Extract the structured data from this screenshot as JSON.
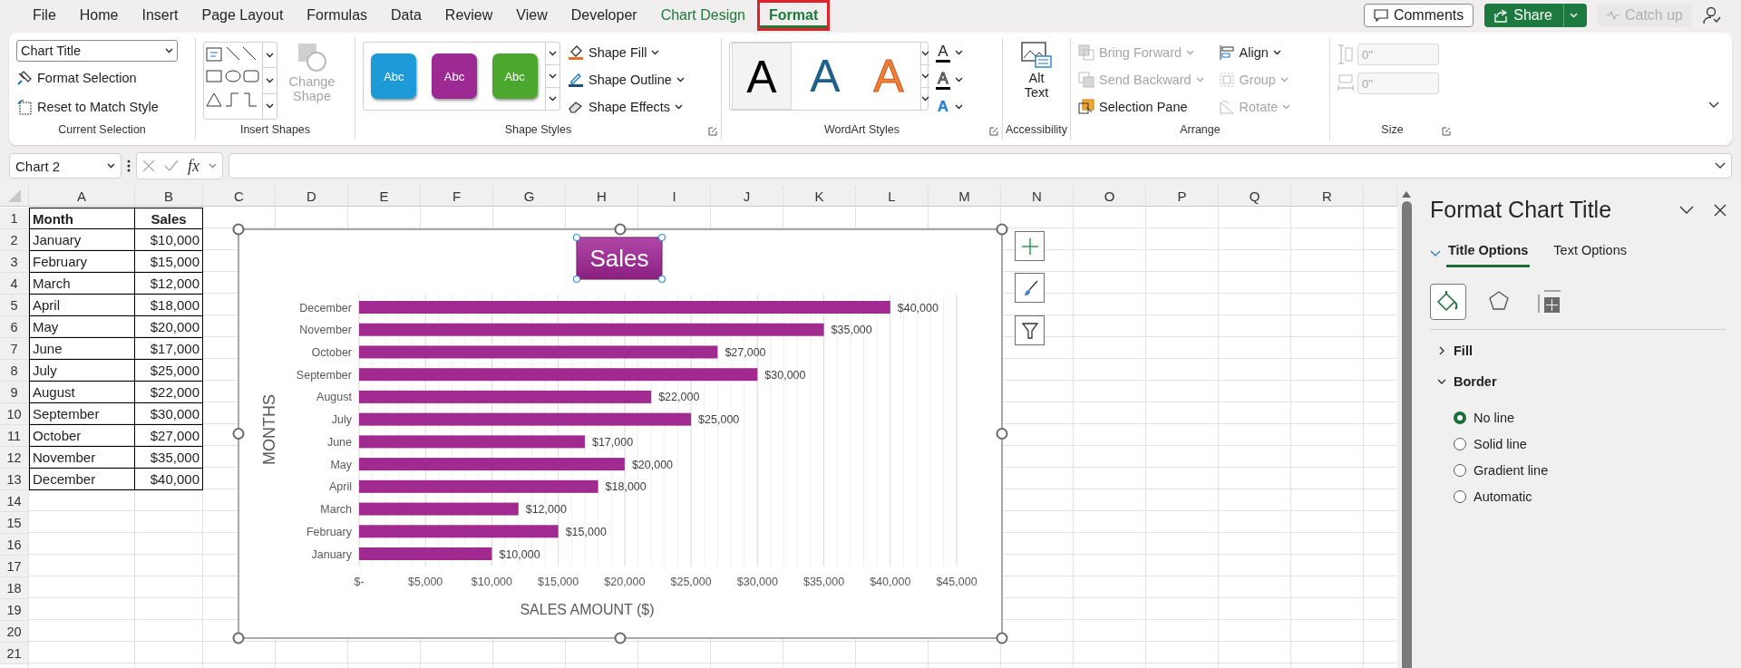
{
  "ribbon_tabs": [
    {
      "label": "File",
      "selected": false,
      "contextual": false,
      "highlighted": false
    },
    {
      "label": "Home",
      "selected": false,
      "contextual": false,
      "highlighted": false
    },
    {
      "label": "Insert",
      "selected": false,
      "contextual": false,
      "highlighted": false
    },
    {
      "label": "Page Layout",
      "selected": false,
      "contextual": false,
      "highlighted": false
    },
    {
      "label": "Formulas",
      "selected": false,
      "contextual": false,
      "highlighted": false
    },
    {
      "label": "Data",
      "selected": false,
      "contextual": false,
      "highlighted": false
    },
    {
      "label": "Review",
      "selected": false,
      "contextual": false,
      "highlighted": false
    },
    {
      "label": "View",
      "selected": false,
      "contextual": false,
      "highlighted": false
    },
    {
      "label": "Developer",
      "selected": false,
      "contextual": false,
      "highlighted": false
    },
    {
      "label": "Chart Design",
      "selected": false,
      "contextual": true,
      "highlighted": false
    },
    {
      "label": "Format",
      "selected": true,
      "contextual": true,
      "highlighted": true
    }
  ],
  "top_actions": {
    "comments": "Comments",
    "share": "Share",
    "catch_up": {
      "label": "Catch up",
      "disabled": true
    }
  },
  "ribbon": {
    "current_selection": {
      "label": "Current Selection",
      "dropdown": "Chart Title",
      "buttons": [
        "Format Selection",
        "Reset to Match Style"
      ]
    },
    "insert_shapes": {
      "label": "Insert Shapes",
      "change_shape": {
        "label": "Change Shape",
        "disabled": true
      }
    },
    "shape_styles": {
      "label": "Shape Styles",
      "swatches": [
        {
          "text": "Abc",
          "color": "#1c9bd8"
        },
        {
          "text": "Abc",
          "color": "#9c2a92"
        },
        {
          "text": "Abc",
          "color": "#4ca72f"
        }
      ],
      "buttons": [
        "Shape Fill",
        "Shape Outline",
        "Shape Effects"
      ]
    },
    "wordart_styles": {
      "label": "WordArt Styles",
      "samples": [
        {
          "text": "A",
          "color": "#000000"
        },
        {
          "text": "A",
          "color": "#1f5f8b"
        },
        {
          "text": "A",
          "color": "#f07f3c"
        }
      ],
      "text_buttons": [
        {
          "text": "A",
          "kind": "fill"
        },
        {
          "text": "A",
          "kind": "outline"
        },
        {
          "text": "A",
          "kind": "effects"
        }
      ]
    },
    "accessibility": {
      "label": "Accessibility",
      "alt_text": "Alt Text"
    },
    "arrange": {
      "label": "Arrange",
      "items": [
        {
          "label": "Bring Forward",
          "disabled": true
        },
        {
          "label": "Send Backward",
          "disabled": true
        },
        {
          "label": "Selection Pane",
          "disabled": false
        },
        {
          "label": "Align",
          "disabled": false
        },
        {
          "label": "Group",
          "disabled": true
        },
        {
          "label": "Rotate",
          "disabled": true
        }
      ]
    },
    "size": {
      "label": "Size",
      "fields": [
        {
          "value": "0\"",
          "disabled": true
        },
        {
          "value": "0\"",
          "disabled": true
        }
      ]
    }
  },
  "formula_bar": {
    "name_box": "Chart 2",
    "fx": "fx"
  },
  "sheet": {
    "columns": [
      "A",
      "B",
      "C",
      "D",
      "E",
      "F",
      "G",
      "H",
      "I",
      "J",
      "K",
      "L",
      "M",
      "N",
      "O",
      "P",
      "Q",
      "R"
    ],
    "row_numbers": [
      "1",
      "2",
      "3",
      "4",
      "5",
      "6",
      "7",
      "8",
      "9",
      "10",
      "11",
      "12",
      "13",
      "14",
      "15",
      "16",
      "17",
      "18",
      "19",
      "20",
      "21"
    ],
    "header": [
      "Month",
      "Sales"
    ],
    "rows": [
      [
        "January",
        "$10,000"
      ],
      [
        "February",
        "$15,000"
      ],
      [
        "March",
        "$12,000"
      ],
      [
        "April",
        "$18,000"
      ],
      [
        "May",
        "$20,000"
      ],
      [
        "June",
        "$17,000"
      ],
      [
        "July",
        "$25,000"
      ],
      [
        "August",
        "$22,000"
      ],
      [
        "September",
        "$30,000"
      ],
      [
        "October",
        "$27,000"
      ],
      [
        "November",
        "$35,000"
      ],
      [
        "December",
        "$40,000"
      ]
    ]
  },
  "chart": {
    "chart_data": {
      "type": "bar",
      "orientation": "horizontal",
      "title": "Sales",
      "xlabel": "SALES AMOUNT ($)",
      "ylabel": "MONTHS",
      "categories": [
        "December",
        "November",
        "October",
        "September",
        "August",
        "July",
        "June",
        "May",
        "April",
        "March",
        "February",
        "January"
      ],
      "series": [
        {
          "color": "#a12a90",
          "values": [
            40000,
            35000,
            27000,
            30000,
            22000,
            25000,
            17000,
            20000,
            18000,
            12000,
            15000,
            10000
          ]
        }
      ],
      "grid": true,
      "xlim": [
        0,
        45000
      ],
      "xticks": [
        {
          "value": 0,
          "label": "$-"
        },
        {
          "value": 5000,
          "label": "$5,000"
        },
        {
          "value": 10000,
          "label": "$10,000"
        },
        {
          "value": 15000,
          "label": "$15,000"
        },
        {
          "value": 20000,
          "label": "$20,000"
        },
        {
          "value": 25000,
          "label": "$25,000"
        },
        {
          "value": 30000,
          "label": "$30,000"
        },
        {
          "value": 35000,
          "label": "$35,000"
        },
        {
          "value": 40000,
          "label": "$40,000"
        },
        {
          "value": 45000,
          "label": "$45,000"
        }
      ],
      "value_labels": [
        "$40,000",
        "$35,000",
        "$27,000",
        "$30,000",
        "$22,000",
        "$25,000",
        "$17,000",
        "$20,000",
        "$18,000",
        "$12,000",
        "$15,000",
        "$10,000"
      ]
    }
  },
  "panel": {
    "title": "Format Chart Title",
    "tabs": [
      {
        "label": "Title Options",
        "selected": true
      },
      {
        "label": "Text Options",
        "selected": false
      }
    ],
    "sections": [
      {
        "label": "Fill",
        "expanded": false
      },
      {
        "label": "Border",
        "expanded": true
      }
    ],
    "border_options": [
      {
        "label": "No line",
        "selected": true
      },
      {
        "label": "Solid line",
        "selected": false
      },
      {
        "label": "Gradient line",
        "selected": false
      },
      {
        "label": "Automatic",
        "selected": false
      }
    ]
  }
}
